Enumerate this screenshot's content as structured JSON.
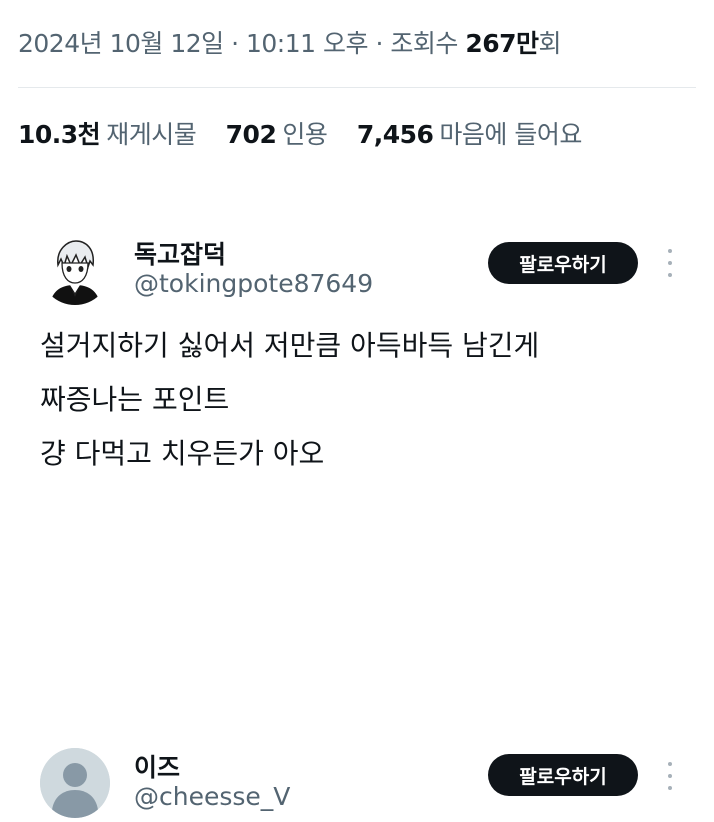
{
  "tweet_meta": {
    "date": "2024년 10월 12일",
    "time": "10:11 오후",
    "views_prefix": "조회수",
    "views_count": "267만",
    "views_suffix": "회"
  },
  "stats": {
    "reposts_count": "10.3천",
    "reposts_label": "재게시물",
    "quotes_count": "702",
    "quotes_label": "인용",
    "likes_count": "7,456",
    "likes_label": "마음에 들어요"
  },
  "replies": [
    {
      "name": "독고잡덕",
      "handle": "@tokingpote87649",
      "follow_label": "팔로우하기",
      "lines": [
        "설거지하기 싫어서 저만큼 아득바득 남긴게",
        "짜증나는 포인트",
        "걍 다먹고 치우든가 아오"
      ]
    },
    {
      "name": "이즈",
      "handle": "@cheesse_V",
      "follow_label": "팔로우하기"
    }
  ],
  "icons": {
    "more": "more-vertical-icon",
    "avatar_default": "default-avatar-icon"
  },
  "colors": {
    "text_primary": "#0f1419",
    "text_secondary": "#536471",
    "button_bg": "#0f1419",
    "avatar_default_bg": "#cfd9de"
  }
}
